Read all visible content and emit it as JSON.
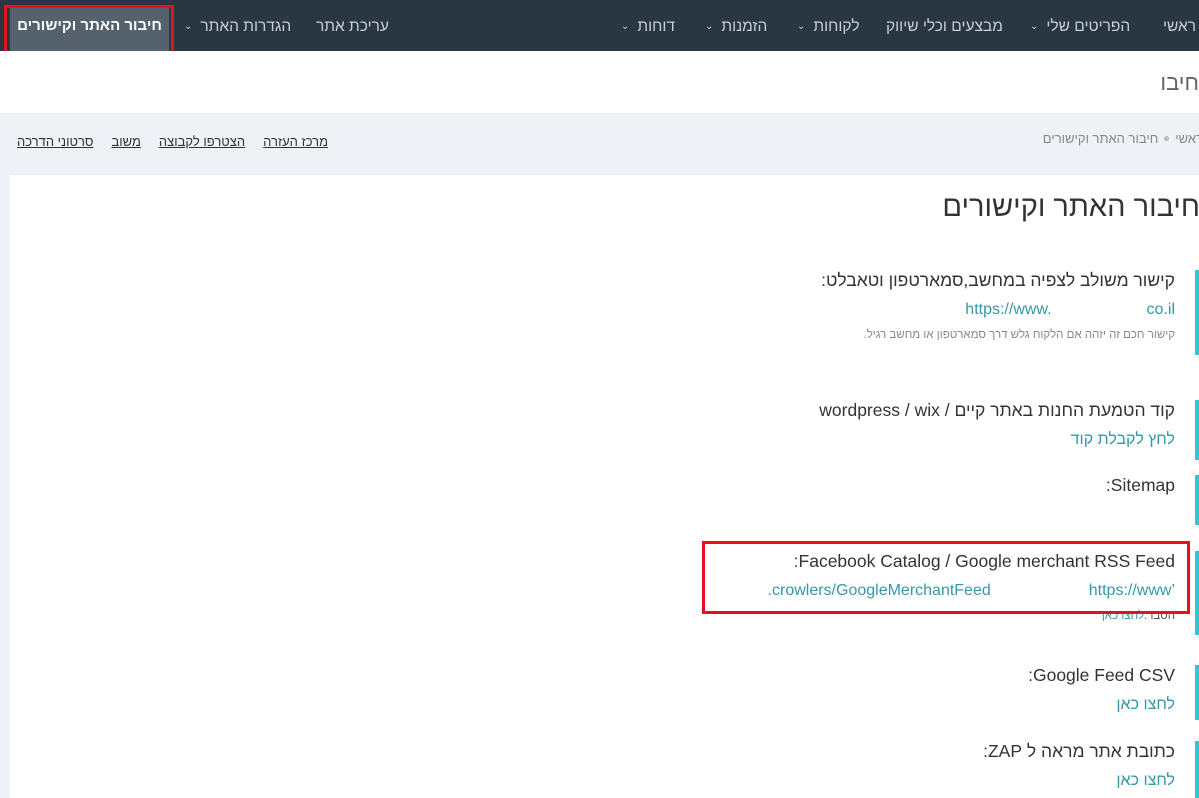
{
  "nav": {
    "home_label": "ראשי",
    "items": [
      {
        "label": "הפריטים שלי"
      },
      {
        "label": "מבצעים וכלי שיווק"
      },
      {
        "label": "לקוחות"
      },
      {
        "label": "הזמנות"
      },
      {
        "label": "דוחות"
      },
      {
        "label": "עריכת אתר"
      },
      {
        "label": "הגדרות האתר"
      }
    ],
    "active_label": "חיבור האתר וקישורים"
  },
  "page_title": "חיבור",
  "breadcrumb": {
    "home": "ראשי",
    "current": "חיבור האתר וקישורים"
  },
  "help_links": [
    "מרכז העזרה",
    "הצטרפו לקבוצה",
    "משוב",
    "סרטוני הדרכה"
  ],
  "card": {
    "title": "חיבור האתר וקישורים",
    "combined_link": {
      "label": "קישור משולב לצפיה במחשב,סמארטפון וטאבלט:",
      "url_start": "https://www.",
      "url_end": "co.il",
      "note": "קישור חכם זה יזהה אם הלקוח גלש דרך סמארטפון או מחשב רגיל."
    },
    "embed_code": {
      "label": "קוד הטמעת החנות באתר קיים / wordpress / wix",
      "link": "לחץ לקבלת קוד"
    },
    "sitemap": {
      "label": "Sitemap:"
    },
    "rss_feed": {
      "label": "Facebook Catalog / Google merchant RSS Feed:",
      "url_start": "https://www.",
      "url_end": "’crowlers/GoogleMerchantFeed",
      "note_label": "הסבר:",
      "note_link": "לחצו כאן"
    },
    "csv_feed": {
      "label": "Google Feed CSV:",
      "link": "לחצו כאן"
    },
    "zap": {
      "label": "כתובת אתר מראה ל ZAP:",
      "link": "לחצו כאן"
    }
  },
  "colors": {
    "navbar": "#2b3643",
    "accent": "#36c6d3",
    "link": "#3598a6",
    "highlight": "#e0141e"
  }
}
